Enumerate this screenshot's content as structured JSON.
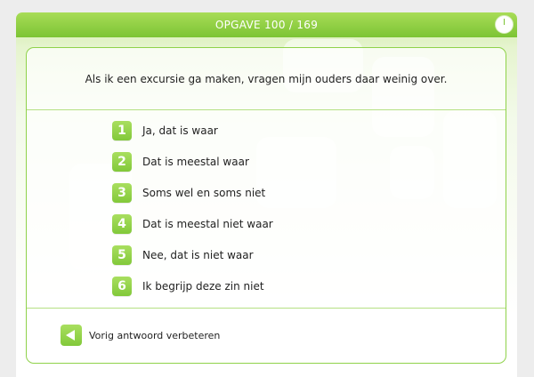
{
  "header": {
    "title": "OPGAVE 100 / 169",
    "timer_icon": "clock-icon"
  },
  "question": {
    "text": "Als ik een excursie ga maken, vragen mijn ouders daar weinig over."
  },
  "answers": [
    {
      "number": "1",
      "label": "Ja, dat is waar"
    },
    {
      "number": "2",
      "label": "Dat is meestal waar"
    },
    {
      "number": "3",
      "label": "Soms wel en soms niet"
    },
    {
      "number": "4",
      "label": "Dat is meestal niet waar"
    },
    {
      "number": "5",
      "label": "Nee, dat is niet waar"
    },
    {
      "number": "6",
      "label": "Ik begrijp deze zin niet"
    }
  ],
  "footer": {
    "back_label": "Vorig antwoord verbeteren",
    "back_icon": "arrow-left-icon"
  },
  "colors": {
    "accent": "#82c93a",
    "header": "#7cc434",
    "border": "#8fd24a"
  }
}
